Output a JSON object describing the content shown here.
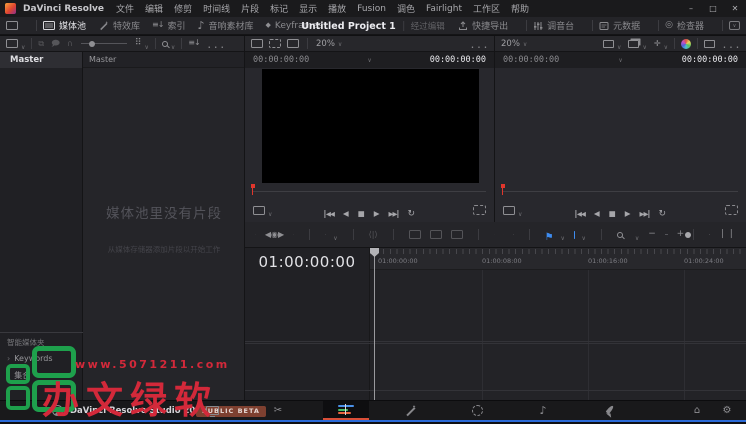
{
  "titlebar": {
    "app_name": "DaVinci Resolve",
    "menus": [
      "文件",
      "编辑",
      "修剪",
      "时间线",
      "片段",
      "标记",
      "显示",
      "播放",
      "Fusion",
      "调色",
      "Fairlight",
      "工作区",
      "帮助"
    ]
  },
  "toolbar": {
    "media_pool_label": "媒体池",
    "effects_label": "特效库",
    "index_label": "索引",
    "sound_library_label": "音响素材库",
    "keyframes_label": "Keyframes",
    "project_title": "Untitled Project 1",
    "project_status": "经过编辑",
    "quick_export_label": "快捷导出",
    "mixer_label": "调音台",
    "metadata_label": "元数据",
    "inspector_label": "检查器"
  },
  "media_pool": {
    "bin_master": "Master",
    "breadcrumb": "Master",
    "empty_title": "媒体池里没有片段",
    "empty_subtitle": "从媒体存储器添加片段以开始工作",
    "smart_bins_header": "智能媒体夹",
    "smart_bin_1": "Keywords",
    "smart_bin_2": "集合"
  },
  "source_viewer": {
    "zoom_level": "20%",
    "tc_position": "00:00:00:00",
    "tc_duration": "00:00:00:00"
  },
  "timeline_viewer": {
    "zoom_level": "20%",
    "tc_position": "00:00:00:00",
    "tc_duration": "00:00:00:00"
  },
  "timeline": {
    "playhead_timecode": "01:00:00:00",
    "ruler_labels": [
      "01:00:00:00",
      "01:00:08:00",
      "01:00:16:00",
      "01:00:24:00"
    ]
  },
  "watermark": {
    "url": "www.5071211.com",
    "brand": "办文绿软"
  },
  "statusbar": {
    "product": "DaVinci Resolve Studio 20",
    "badge": "PUBLIC BETA"
  },
  "colors": {
    "page_accent_red": "#d94f38",
    "flag_blue": "#3e8cf0",
    "marker_blue": "#3e8cf0",
    "watermark_red": "#d3293a",
    "watermark_green": "#1ea04c",
    "beta_badge_bg": "#7e4030",
    "playhead_red": "#e0362c"
  }
}
